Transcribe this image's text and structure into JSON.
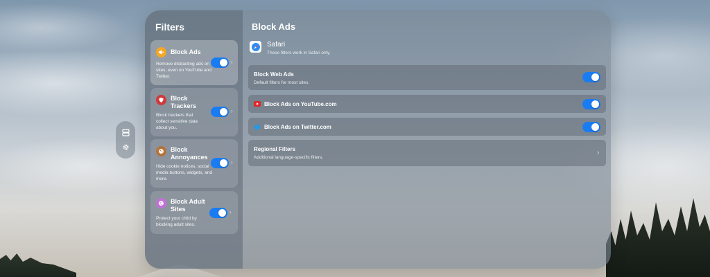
{
  "sidebar": {
    "title": "Filters",
    "items": [
      {
        "label": "Block Ads",
        "description": "Remove distracting ads on sites, even on YouTube and Twitter.",
        "icon": "megaphone-icon",
        "enabled": true,
        "selected": true
      },
      {
        "label": "Block Trackers",
        "description": "Block trackers that collect sensitive data about you.",
        "icon": "shield-icon",
        "enabled": true,
        "selected": false
      },
      {
        "label": "Block Annoyances",
        "description": "Hide cookie notices, social media buttons, widgets, and more.",
        "icon": "cookie-icon",
        "enabled": true,
        "selected": false
      },
      {
        "label": "Block Adult Sites",
        "description": "Protect your child by blocking adult sites.",
        "icon": "smile-icon",
        "enabled": true,
        "selected": false
      }
    ]
  },
  "content": {
    "title": "Block Ads",
    "browser": {
      "name": "Safari",
      "note": "These filters work in Safari only."
    },
    "rows": [
      {
        "title": "Block Web Ads",
        "subtitle": "Default filters for most sites.",
        "enabled": true
      },
      {
        "title": "Block Ads on YouTube.com",
        "icon": "youtube-icon",
        "enabled": true
      },
      {
        "title": "Block Ads on Twitter.com",
        "icon": "twitter-icon",
        "enabled": true
      },
      {
        "title": "Regional Filters",
        "subtitle": "Additional language-specific filters.",
        "chevron": true
      }
    ]
  },
  "ornament": {
    "icons": [
      "storage-icon",
      "gear-icon"
    ]
  },
  "colors": {
    "accent": "#1a7cf2",
    "ads_icon": "#f5a623",
    "trackers_icon": "#d03a3a",
    "annoyances_icon": "#b5743a",
    "adult_icon": "#c470d8"
  }
}
